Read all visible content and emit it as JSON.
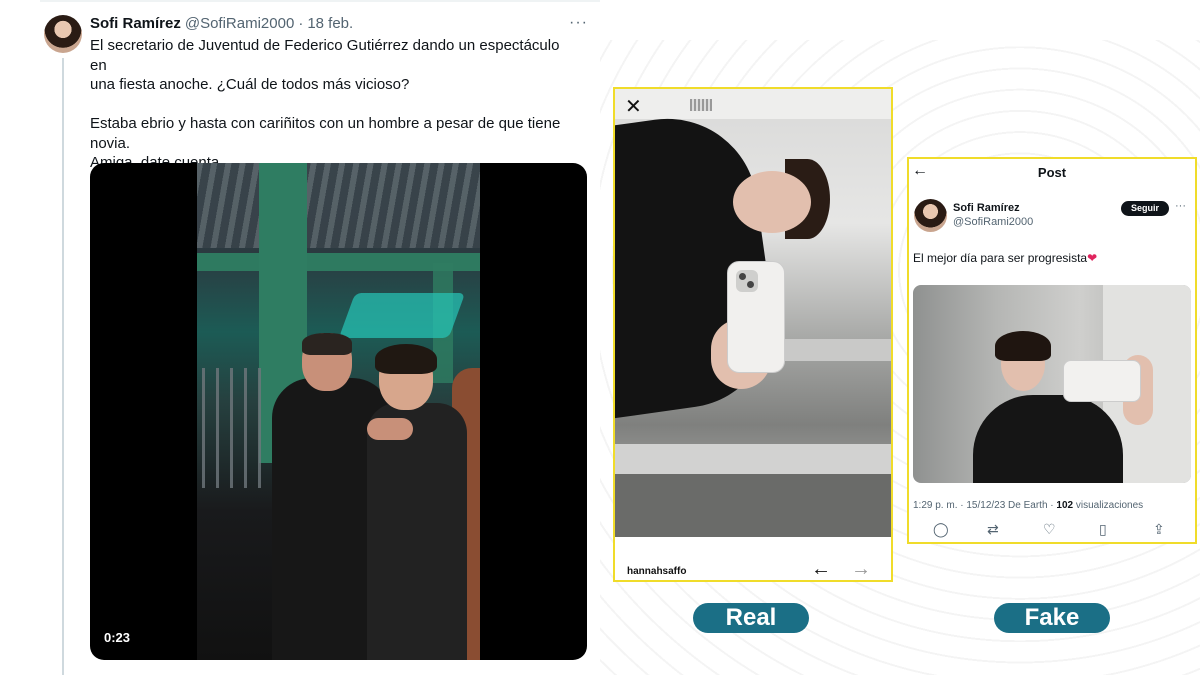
{
  "tweet": {
    "author_name": "Sofi Ramírez",
    "author_handle": "@SofiRami2000",
    "separator": "·",
    "date": "18 feb.",
    "more_icon": "···",
    "text_lines": [
      "El secretario de Juventud de Federico Gutiérrez dando un espectáculo en",
      "una fiesta anoche. ¿Cuál de todos más vicioso?",
      "",
      "Estaba ebrio y hasta con cariñitos con un hombre a pesar de que tiene",
      "novia.",
      "Amiga, date cuenta."
    ],
    "video_duration": "0:23"
  },
  "real_panel": {
    "close_icon": "✕",
    "username": "hannahsaffo",
    "prev_icon": "←",
    "next_icon": "→",
    "label": "Real"
  },
  "fake_panel": {
    "back_icon": "←",
    "title": "Post",
    "author_name": "Sofi Ramírez",
    "author_handle": "@SofiRami2000",
    "follow_label": "Seguir",
    "more_icon": "···",
    "text": "El mejor día para ser progresista",
    "heart_emoji": "❤",
    "meta_time": "1:29 p. m. · 15/12/23 De Earth · ",
    "meta_views_count": "102",
    "meta_views_label": " visualizaciones",
    "actions": {
      "reply_icon": "◯",
      "retweet_icon": "⇄",
      "like_icon": "♡",
      "bookmark_icon": "▯",
      "share_icon": "⇪"
    },
    "label": "Fake"
  }
}
